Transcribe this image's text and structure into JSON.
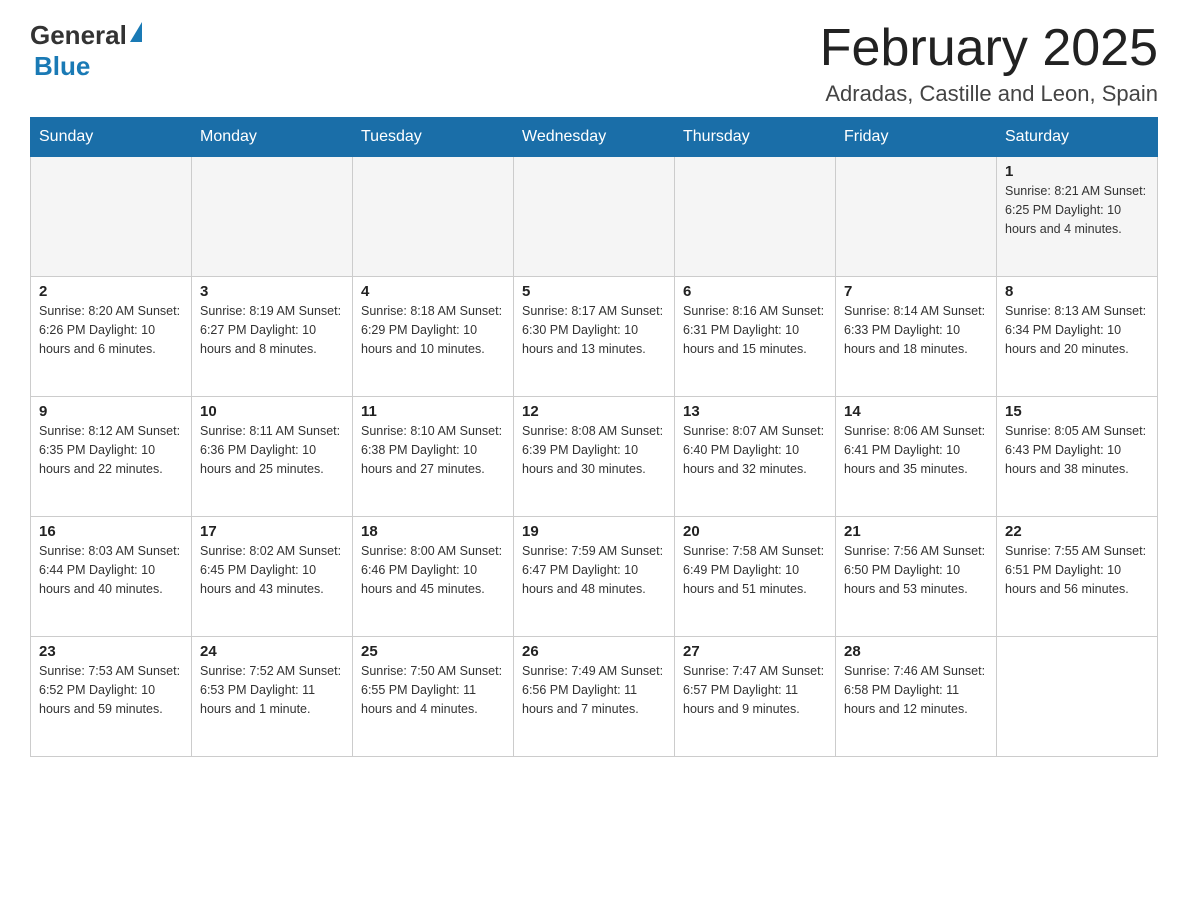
{
  "header": {
    "title": "February 2025",
    "subtitle": "Adradas, Castille and Leon, Spain",
    "logo_general": "General",
    "logo_blue": "Blue"
  },
  "days_of_week": [
    "Sunday",
    "Monday",
    "Tuesday",
    "Wednesday",
    "Thursday",
    "Friday",
    "Saturday"
  ],
  "weeks": [
    [
      {
        "day": "",
        "info": ""
      },
      {
        "day": "",
        "info": ""
      },
      {
        "day": "",
        "info": ""
      },
      {
        "day": "",
        "info": ""
      },
      {
        "day": "",
        "info": ""
      },
      {
        "day": "",
        "info": ""
      },
      {
        "day": "1",
        "info": "Sunrise: 8:21 AM\nSunset: 6:25 PM\nDaylight: 10 hours and 4 minutes."
      }
    ],
    [
      {
        "day": "2",
        "info": "Sunrise: 8:20 AM\nSunset: 6:26 PM\nDaylight: 10 hours and 6 minutes."
      },
      {
        "day": "3",
        "info": "Sunrise: 8:19 AM\nSunset: 6:27 PM\nDaylight: 10 hours and 8 minutes."
      },
      {
        "day": "4",
        "info": "Sunrise: 8:18 AM\nSunset: 6:29 PM\nDaylight: 10 hours and 10 minutes."
      },
      {
        "day": "5",
        "info": "Sunrise: 8:17 AM\nSunset: 6:30 PM\nDaylight: 10 hours and 13 minutes."
      },
      {
        "day": "6",
        "info": "Sunrise: 8:16 AM\nSunset: 6:31 PM\nDaylight: 10 hours and 15 minutes."
      },
      {
        "day": "7",
        "info": "Sunrise: 8:14 AM\nSunset: 6:33 PM\nDaylight: 10 hours and 18 minutes."
      },
      {
        "day": "8",
        "info": "Sunrise: 8:13 AM\nSunset: 6:34 PM\nDaylight: 10 hours and 20 minutes."
      }
    ],
    [
      {
        "day": "9",
        "info": "Sunrise: 8:12 AM\nSunset: 6:35 PM\nDaylight: 10 hours and 22 minutes."
      },
      {
        "day": "10",
        "info": "Sunrise: 8:11 AM\nSunset: 6:36 PM\nDaylight: 10 hours and 25 minutes."
      },
      {
        "day": "11",
        "info": "Sunrise: 8:10 AM\nSunset: 6:38 PM\nDaylight: 10 hours and 27 minutes."
      },
      {
        "day": "12",
        "info": "Sunrise: 8:08 AM\nSunset: 6:39 PM\nDaylight: 10 hours and 30 minutes."
      },
      {
        "day": "13",
        "info": "Sunrise: 8:07 AM\nSunset: 6:40 PM\nDaylight: 10 hours and 32 minutes."
      },
      {
        "day": "14",
        "info": "Sunrise: 8:06 AM\nSunset: 6:41 PM\nDaylight: 10 hours and 35 minutes."
      },
      {
        "day": "15",
        "info": "Sunrise: 8:05 AM\nSunset: 6:43 PM\nDaylight: 10 hours and 38 minutes."
      }
    ],
    [
      {
        "day": "16",
        "info": "Sunrise: 8:03 AM\nSunset: 6:44 PM\nDaylight: 10 hours and 40 minutes."
      },
      {
        "day": "17",
        "info": "Sunrise: 8:02 AM\nSunset: 6:45 PM\nDaylight: 10 hours and 43 minutes."
      },
      {
        "day": "18",
        "info": "Sunrise: 8:00 AM\nSunset: 6:46 PM\nDaylight: 10 hours and 45 minutes."
      },
      {
        "day": "19",
        "info": "Sunrise: 7:59 AM\nSunset: 6:47 PM\nDaylight: 10 hours and 48 minutes."
      },
      {
        "day": "20",
        "info": "Sunrise: 7:58 AM\nSunset: 6:49 PM\nDaylight: 10 hours and 51 minutes."
      },
      {
        "day": "21",
        "info": "Sunrise: 7:56 AM\nSunset: 6:50 PM\nDaylight: 10 hours and 53 minutes."
      },
      {
        "day": "22",
        "info": "Sunrise: 7:55 AM\nSunset: 6:51 PM\nDaylight: 10 hours and 56 minutes."
      }
    ],
    [
      {
        "day": "23",
        "info": "Sunrise: 7:53 AM\nSunset: 6:52 PM\nDaylight: 10 hours and 59 minutes."
      },
      {
        "day": "24",
        "info": "Sunrise: 7:52 AM\nSunset: 6:53 PM\nDaylight: 11 hours and 1 minute."
      },
      {
        "day": "25",
        "info": "Sunrise: 7:50 AM\nSunset: 6:55 PM\nDaylight: 11 hours and 4 minutes."
      },
      {
        "day": "26",
        "info": "Sunrise: 7:49 AM\nSunset: 6:56 PM\nDaylight: 11 hours and 7 minutes."
      },
      {
        "day": "27",
        "info": "Sunrise: 7:47 AM\nSunset: 6:57 PM\nDaylight: 11 hours and 9 minutes."
      },
      {
        "day": "28",
        "info": "Sunrise: 7:46 AM\nSunset: 6:58 PM\nDaylight: 11 hours and 12 minutes."
      },
      {
        "day": "",
        "info": ""
      }
    ]
  ]
}
